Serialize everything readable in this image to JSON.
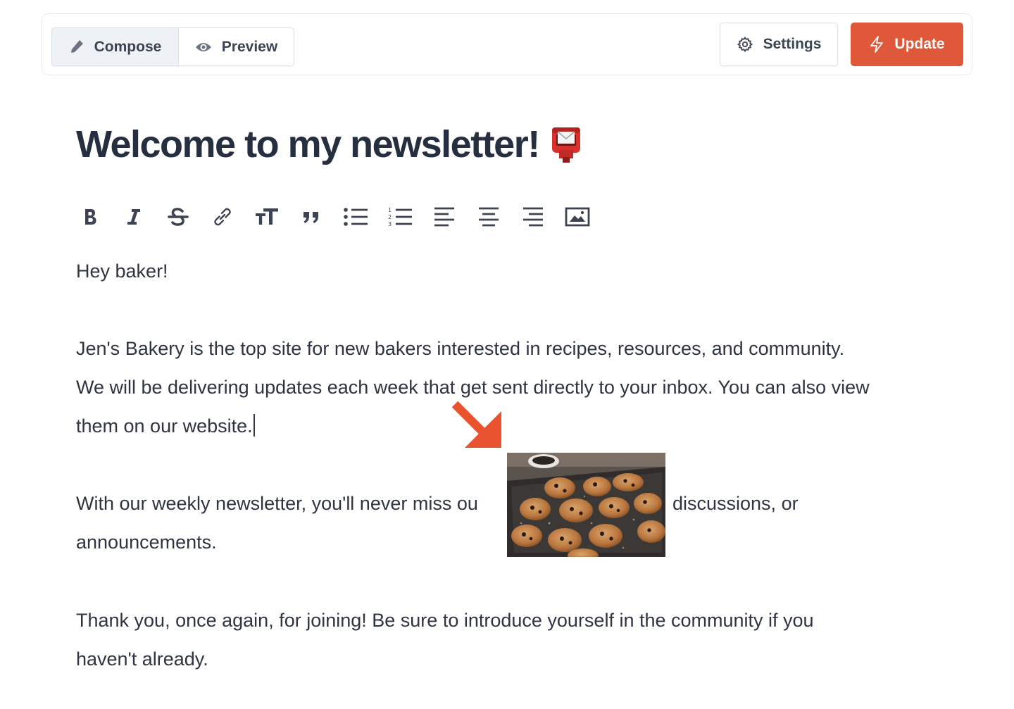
{
  "topbar": {
    "compose_label": "Compose",
    "preview_label": "Preview",
    "settings_label": "Settings",
    "update_label": "Update"
  },
  "editor": {
    "title": "Welcome to my newsletter!",
    "title_emoji_icon": "postbox-icon",
    "toolbar": [
      "bold-icon",
      "italic-icon",
      "strikethrough-icon",
      "link-icon",
      "text-size-icon",
      "quote-icon",
      "bulleted-list-icon",
      "numbered-list-icon",
      "align-left-icon",
      "align-center-icon",
      "align-right-icon",
      "image-icon"
    ],
    "paragraphs": {
      "greeting": "Hey baker!",
      "intro_line1": "Jen's Bakery is the top site for new bakers interested in recipes, resources, and community.",
      "intro_line2": "We will be delivering updates each week that get sent directly to your inbox. You can also view",
      "intro_line3": "them on our website.",
      "weekly_line1a": "With our weekly newsletter, you'll never miss ou",
      "weekly_line1b": "discussions, or",
      "weekly_line2": "announcements.",
      "thanks_line1": "Thank you, once again, for joining! Be sure to introduce yourself in the community if you",
      "thanks_line2": "haven't already."
    }
  },
  "colors": {
    "accent": "#e0583a",
    "text": "#2e3441",
    "compose_active_bg": "#eef1f5"
  }
}
